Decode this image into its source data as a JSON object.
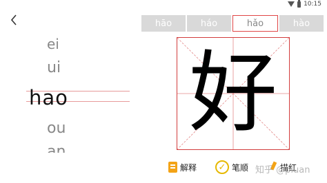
{
  "status_bar": {
    "time": "10:15"
  },
  "pinyin_list": {
    "items": [
      "ei",
      "ui",
      "hao",
      "ou",
      "an"
    ],
    "selected": "hao"
  },
  "tone_tabs": [
    "hāo",
    "háo",
    "hǎo",
    "hào"
  ],
  "active_tone": 2,
  "character": "好",
  "toolbar": {
    "explain_label": "解释",
    "stroke_label": "笔顺",
    "trace_label": "描红"
  },
  "watermark": "知乎 @pluan",
  "colors": {
    "grid_red": "#d23b3b",
    "tab_gray": "#d9d9d9",
    "icon_orange": "#f3a316",
    "check_yellow": "#e6b800"
  }
}
